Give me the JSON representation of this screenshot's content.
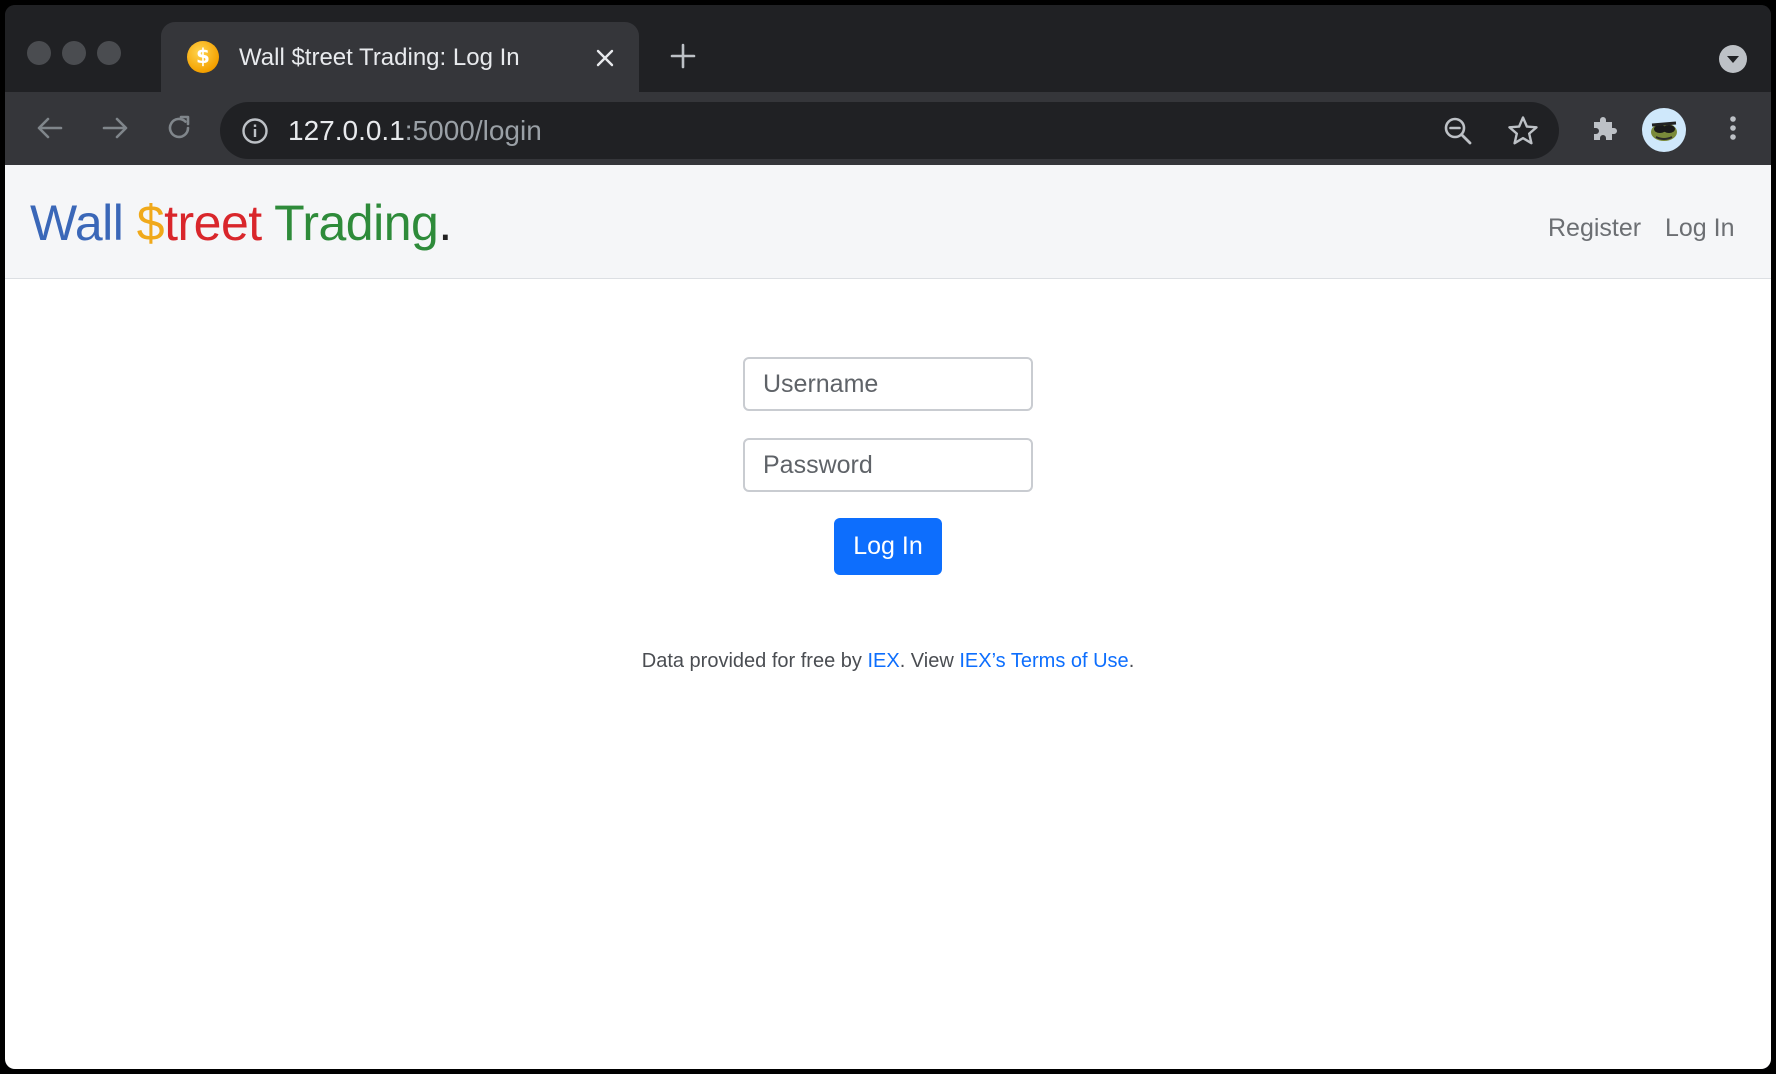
{
  "browser": {
    "tab": {
      "title": "Wall $treet Trading: Log In",
      "favicon_glyph": "$"
    },
    "address_bar": {
      "host": "127.0.0.1",
      "path": ":5000/login"
    },
    "icons": {
      "back": "back-arrow-icon",
      "forward": "forward-arrow-icon",
      "reload": "reload-icon",
      "info": "info-icon",
      "zoom": "zoom-out-icon",
      "bookmark": "star-icon",
      "extensions": "puzzle-icon",
      "menu": "kebab-menu-icon"
    }
  },
  "navbar": {
    "brand": {
      "part1": "Wall",
      "part2_symbol": "$",
      "part2_rest": "treet",
      "part3": "Trading",
      "part4": "."
    },
    "links": {
      "register": "Register",
      "login": "Log In"
    }
  },
  "form": {
    "username_placeholder": "Username",
    "password_placeholder": "Password",
    "submit_label": "Log In"
  },
  "footer": {
    "prefix": "Data provided for free by",
    "iex_link": "IEX",
    "middle": ". View",
    "terms_link": "IEX’s Terms of Use",
    "suffix": "."
  },
  "colors": {
    "brand_blue": "#3a67b8",
    "brand_yellow": "#f0a91a",
    "brand_red": "#d9262b",
    "brand_green": "#2e8b3a",
    "primary_button": "#0d6efd"
  }
}
